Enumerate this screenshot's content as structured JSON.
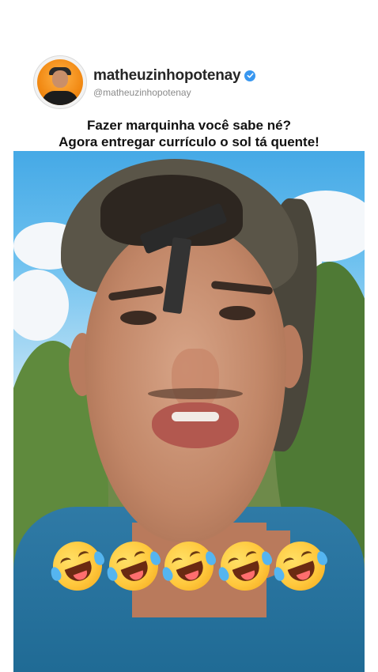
{
  "post": {
    "display_name": "matheuzinhopotenay",
    "handle": "@matheuzinhopotenay",
    "verified": true,
    "caption_line1": "Fazer marquinha você sabe né?",
    "caption_line2": "Agora entregar currículo o sol tá quente!"
  },
  "video": {
    "overlay_emojis": [
      "🤣",
      "🤣",
      "🤣",
      "🤣",
      "🤣"
    ],
    "overlay_emoji_name": "rolling-on-the-floor-laughing"
  },
  "colors": {
    "verified_badge": "#3897f0",
    "name_text": "#262626",
    "handle_text": "#8a8a8a"
  }
}
